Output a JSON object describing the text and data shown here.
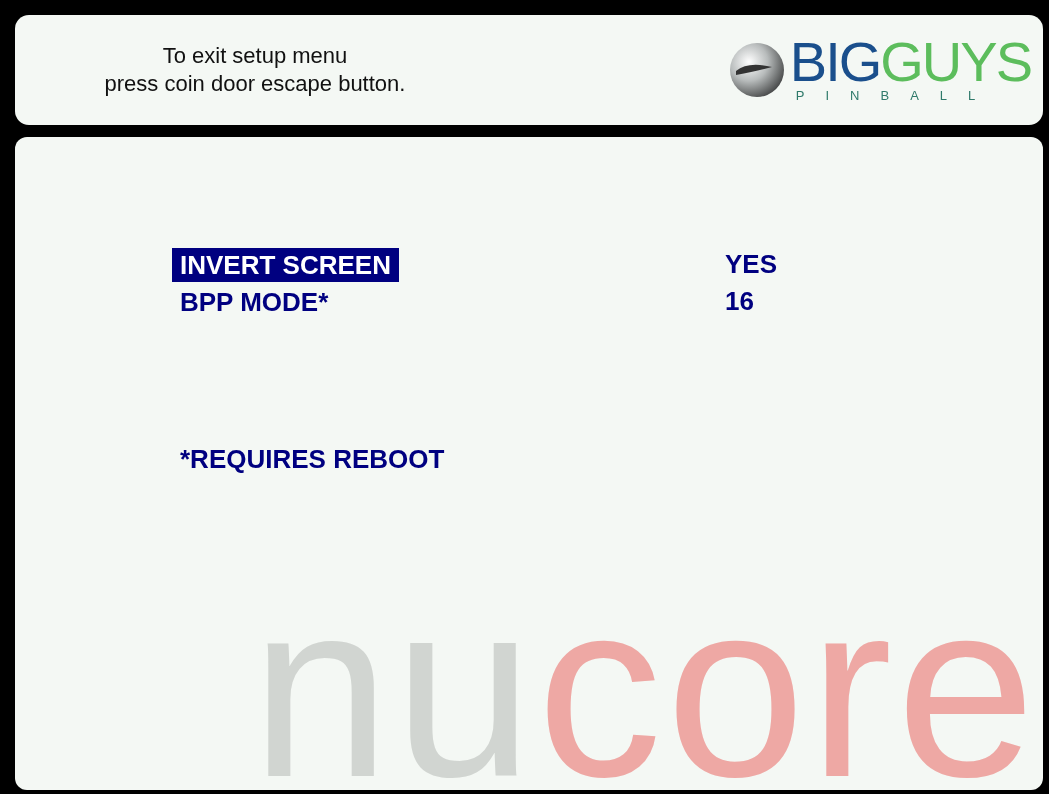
{
  "header": {
    "instructions": [
      "To exit setup menu",
      "press coin door escape button."
    ],
    "logo": {
      "word_1": "BIG",
      "word_2": "GUYS",
      "subtitle": "PINBALL"
    }
  },
  "menu": {
    "items": [
      {
        "label": "INVERT SCREEN",
        "value": "YES",
        "selected": true
      },
      {
        "label": "BPP MODE*",
        "value": "16",
        "selected": false
      }
    ],
    "footnote": "*REQUIRES REBOOT"
  },
  "brand_mark": {
    "parts": [
      {
        "text": "nu",
        "color": "#d1d5d1"
      },
      {
        "text": "core",
        "color": "#eea8a4"
      }
    ]
  }
}
